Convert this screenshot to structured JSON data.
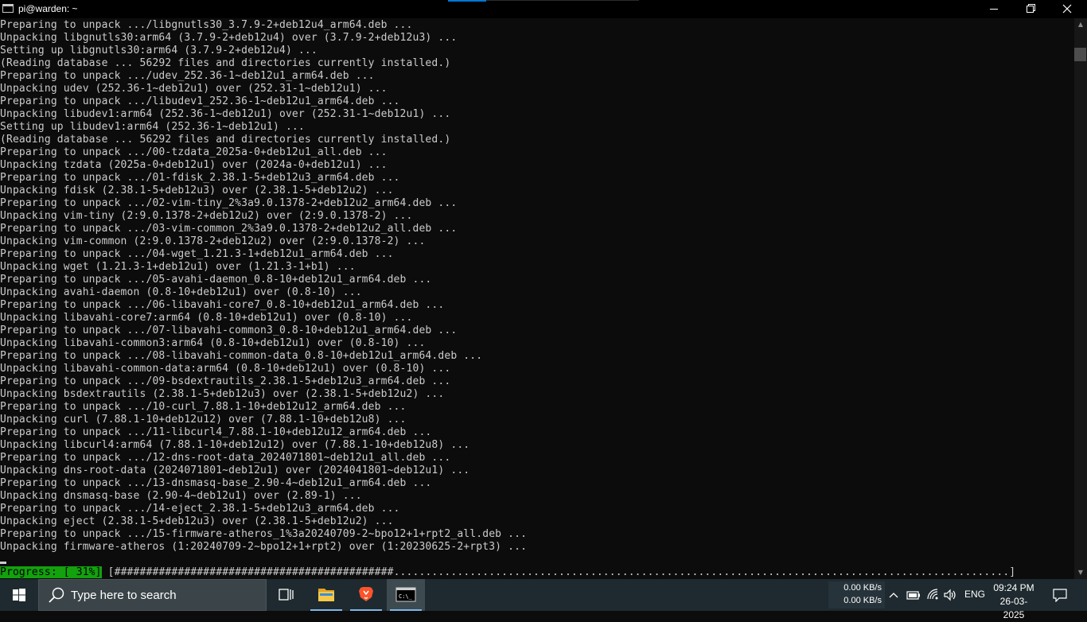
{
  "window": {
    "title": "pi@warden: ~",
    "accent_color": "#0078d7"
  },
  "console": {
    "lines": [
      "Preparing to unpack .../libgnutls30_3.7.9-2+deb12u4_arm64.deb ...",
      "Unpacking libgnutls30:arm64 (3.7.9-2+deb12u4) over (3.7.9-2+deb12u3) ...",
      "Setting up libgnutls30:arm64 (3.7.9-2+deb12u4) ...",
      "(Reading database ... 56292 files and directories currently installed.)",
      "Preparing to unpack .../udev_252.36-1~deb12u1_arm64.deb ...",
      "Unpacking udev (252.36-1~deb12u1) over (252.31-1~deb12u1) ...",
      "Preparing to unpack .../libudev1_252.36-1~deb12u1_arm64.deb ...",
      "Unpacking libudev1:arm64 (252.36-1~deb12u1) over (252.31-1~deb12u1) ...",
      "Setting up libudev1:arm64 (252.36-1~deb12u1) ...",
      "(Reading database ... 56292 files and directories currently installed.)",
      "Preparing to unpack .../00-tzdata_2025a-0+deb12u1_all.deb ...",
      "Unpacking tzdata (2025a-0+deb12u1) over (2024a-0+deb12u1) ...",
      "Preparing to unpack .../01-fdisk_2.38.1-5+deb12u3_arm64.deb ...",
      "Unpacking fdisk (2.38.1-5+deb12u3) over (2.38.1-5+deb12u2) ...",
      "Preparing to unpack .../02-vim-tiny_2%3a9.0.1378-2+deb12u2_arm64.deb ...",
      "Unpacking vim-tiny (2:9.0.1378-2+deb12u2) over (2:9.0.1378-2) ...",
      "Preparing to unpack .../03-vim-common_2%3a9.0.1378-2+deb12u2_all.deb ...",
      "Unpacking vim-common (2:9.0.1378-2+deb12u2) over (2:9.0.1378-2) ...",
      "Preparing to unpack .../04-wget_1.21.3-1+deb12u1_arm64.deb ...",
      "Unpacking wget (1.21.3-1+deb12u1) over (1.21.3-1+b1) ...",
      "Preparing to unpack .../05-avahi-daemon_0.8-10+deb12u1_arm64.deb ...",
      "Unpacking avahi-daemon (0.8-10+deb12u1) over (0.8-10) ...",
      "Preparing to unpack .../06-libavahi-core7_0.8-10+deb12u1_arm64.deb ...",
      "Unpacking libavahi-core7:arm64 (0.8-10+deb12u1) over (0.8-10) ...",
      "Preparing to unpack .../07-libavahi-common3_0.8-10+deb12u1_arm64.deb ...",
      "Unpacking libavahi-common3:arm64 (0.8-10+deb12u1) over (0.8-10) ...",
      "Preparing to unpack .../08-libavahi-common-data_0.8-10+deb12u1_arm64.deb ...",
      "Unpacking libavahi-common-data:arm64 (0.8-10+deb12u1) over (0.8-10) ...",
      "Preparing to unpack .../09-bsdextrautils_2.38.1-5+deb12u3_arm64.deb ...",
      "Unpacking bsdextrautils (2.38.1-5+deb12u3) over (2.38.1-5+deb12u2) ...",
      "Preparing to unpack .../10-curl_7.88.1-10+deb12u12_arm64.deb ...",
      "Unpacking curl (7.88.1-10+deb12u12) over (7.88.1-10+deb12u8) ...",
      "Preparing to unpack .../11-libcurl4_7.88.1-10+deb12u12_arm64.deb ...",
      "Unpacking libcurl4:arm64 (7.88.1-10+deb12u12) over (7.88.1-10+deb12u8) ...",
      "Preparing to unpack .../12-dns-root-data_2024071801~deb12u1_all.deb ...",
      "Unpacking dns-root-data (2024071801~deb12u1) over (2024041801~deb12u1) ...",
      "Preparing to unpack .../13-dnsmasq-base_2.90-4~deb12u1_arm64.deb ...",
      "Unpacking dnsmasq-base (2.90-4~deb12u1) over (2.89-1) ...",
      "Preparing to unpack .../14-eject_2.38.1-5+deb12u3_arm64.deb ...",
      "Unpacking eject (2.38.1-5+deb12u3) over (2.38.1-5+deb12u2) ...",
      "Preparing to unpack .../15-firmware-atheros_1%3a20240709-2~bpo12+1+rpt2_all.deb ...",
      "Unpacking firmware-atheros (1:20240709-2~bpo12+1+rpt2) over (1:20230625-2+rpt3) ..."
    ],
    "progress": {
      "label": "Progress: [ 31%]",
      "percent": 31,
      "bar": "[############################################.................................................................................................]",
      "label_color": "#13a10e"
    }
  },
  "taskbar": {
    "search_placeholder": "Type here to search",
    "apps": [
      "task-view",
      "file-explorer",
      "brave-browser",
      "command-prompt"
    ],
    "tray": {
      "upload_speed": "0.00 KB/s",
      "download_speed": "0.00 KB/s",
      "language": "ENG",
      "time": "09:24 PM",
      "date": "26-03-2025"
    }
  }
}
